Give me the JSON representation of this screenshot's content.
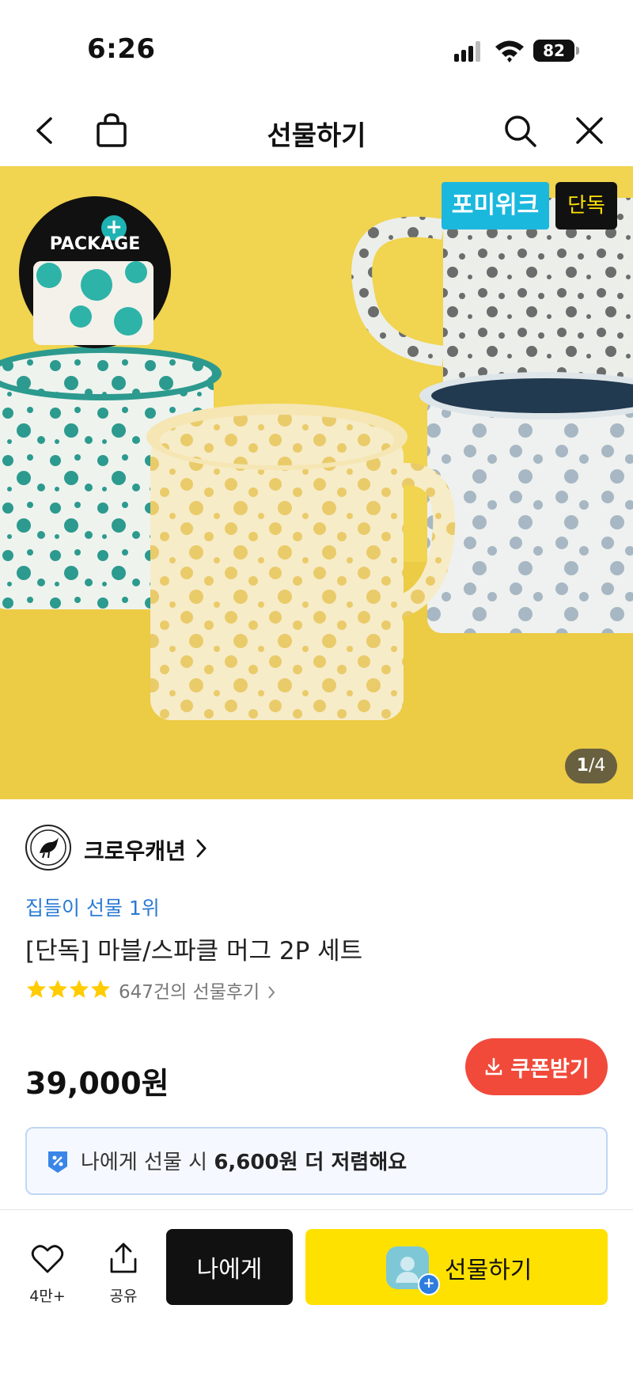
{
  "status_bar": {
    "time": "6:26",
    "battery": "82"
  },
  "nav": {
    "title": "선물하기"
  },
  "hero": {
    "package_label": "PACKAGE",
    "package_plus": "+",
    "promo_tag": "포미위크",
    "exclusive_tag": "단독",
    "counter_current": "1",
    "counter_total": "/4"
  },
  "brand": {
    "name": "크로우캐년"
  },
  "product": {
    "rank": "집들이 선물 1위",
    "title": "[단독] 마블/스파클 머그 2P 세트",
    "rating_stars": 4,
    "review_count": "647건의 선물후기",
    "price": "39,000원"
  },
  "coupon": {
    "label": "쿠폰받기"
  },
  "discount": {
    "prefix": "나에게 선물 시 ",
    "amount": "6,600원 더 저렴해요"
  },
  "bottom": {
    "wish_count": "4만+",
    "share_label": "공유",
    "self_label": "나에게",
    "gift_label": "선물하기",
    "gift_plus": "+"
  },
  "colors": {
    "hero_bg": "#f1d44f",
    "rank_blue": "#2a7ad4",
    "coupon_red": "#f14a3b",
    "gift_yellow": "#ffe100",
    "star_yellow": "#ffcc00"
  }
}
